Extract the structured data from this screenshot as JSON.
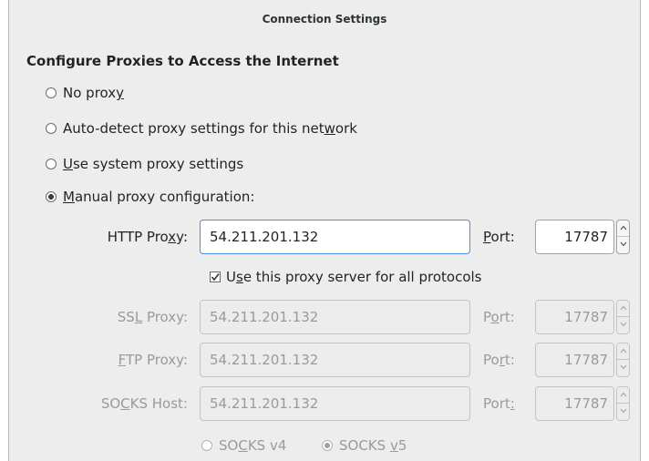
{
  "window": {
    "title": "Connection Settings"
  },
  "section_title": "Configure Proxies to Access the Internet",
  "proxy_options": [
    {
      "pre": "No prox",
      "u": "y",
      "post": "",
      "checked": false
    },
    {
      "pre": "Auto-detect proxy settings for this net",
      "u": "w",
      "post": "ork",
      "checked": false
    },
    {
      "pre": "",
      "u": "U",
      "post": "se system proxy settings",
      "checked": false
    },
    {
      "pre": "",
      "u": "M",
      "post": "anual proxy configuration:",
      "checked": true
    }
  ],
  "http": {
    "label_pre": "HTTP Pro",
    "label_u": "x",
    "label_post": "y:",
    "value": "54.211.201.132",
    "port_label_pre": "",
    "port_label_u": "P",
    "port_label_post": "ort:",
    "port": "17787"
  },
  "share_all": {
    "pre": "U",
    "u": "s",
    "post": "e this proxy server for all protocols",
    "checked": true
  },
  "ssl": {
    "label_pre": "SS",
    "label_u": "L",
    "label_post": " Proxy:",
    "value": "54.211.201.132",
    "port_label_pre": "P",
    "port_label_u": "o",
    "port_label_post": "rt:",
    "port": "17787"
  },
  "ftp": {
    "label_pre": "",
    "label_u": "F",
    "label_post": "TP Proxy:",
    "value": "54.211.201.132",
    "port_label_pre": "Po",
    "port_label_u": "r",
    "port_label_post": "t:",
    "port": "17787"
  },
  "socks": {
    "label_pre": "SO",
    "label_u": "C",
    "label_post": "KS Host:",
    "value": "54.211.201.132",
    "port_label_pre": "Port",
    "port_label_u": ":",
    "port_label_post": "",
    "port": "17787"
  },
  "socks_versions": [
    {
      "pre": "SO",
      "u": "C",
      "post": "KS v4",
      "checked": false
    },
    {
      "pre": "SOCKS ",
      "u": "v",
      "post": "5",
      "checked": true
    }
  ]
}
